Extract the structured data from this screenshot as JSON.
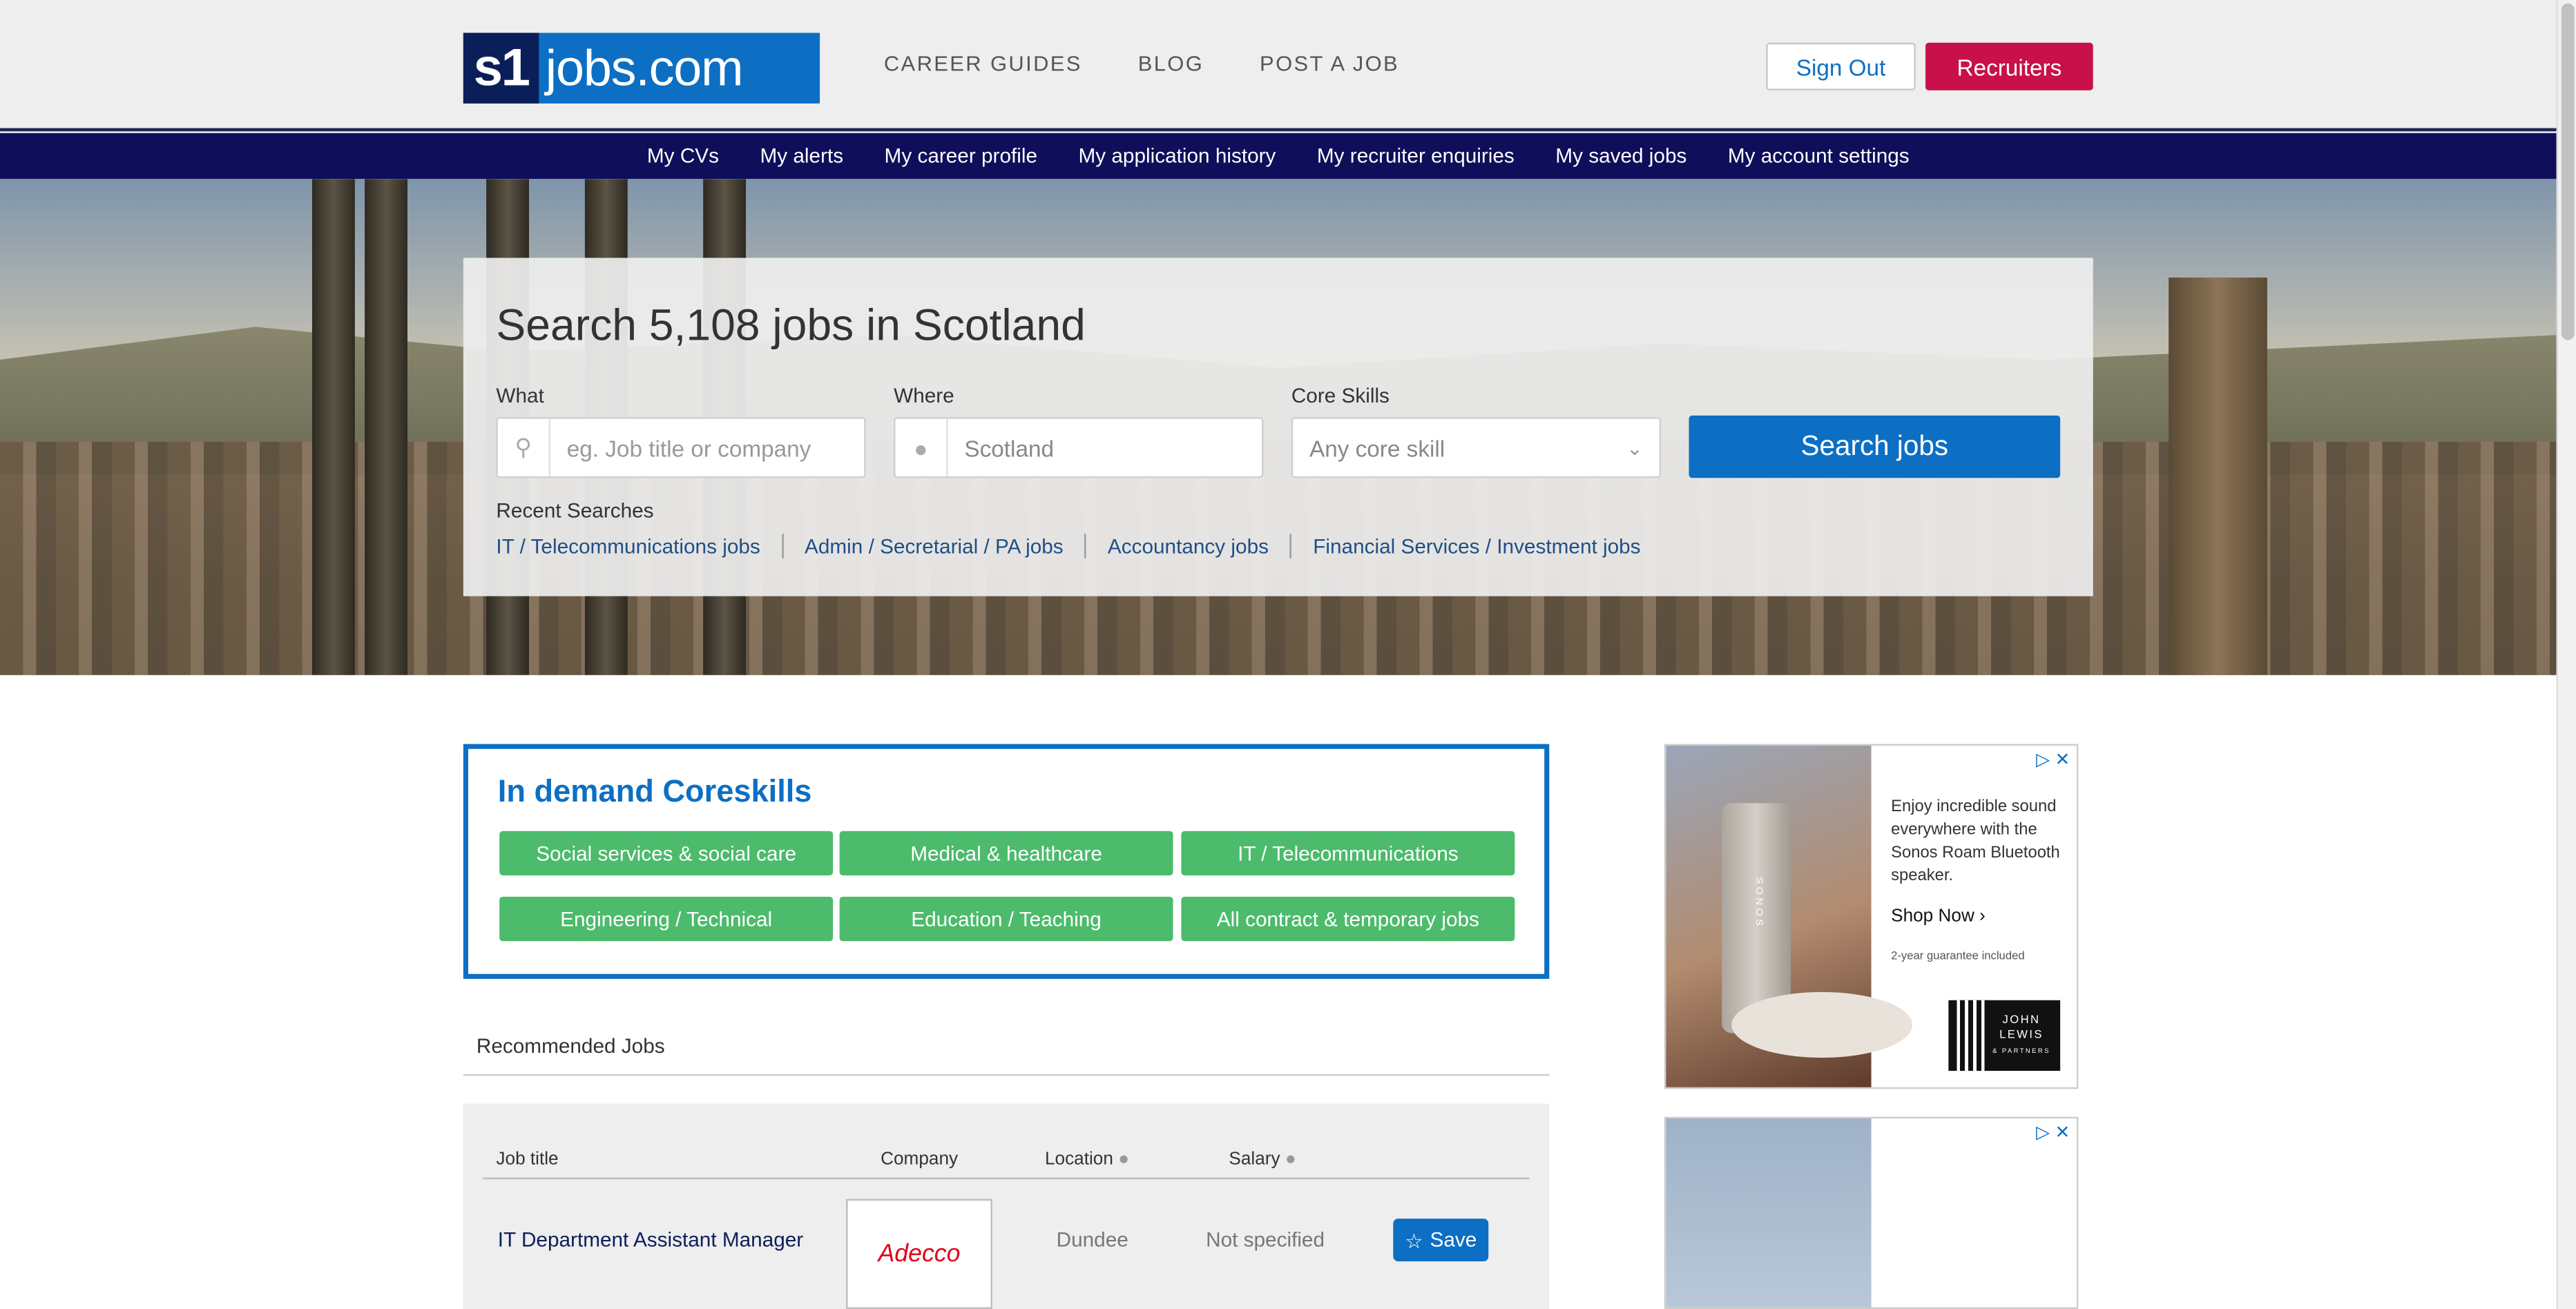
{
  "header": {
    "logo": {
      "mark": "s1",
      "text": "jobs.com"
    },
    "nav": [
      "CAREER GUIDES",
      "BLOG",
      "POST A JOB"
    ],
    "sign_out": "Sign Out",
    "recruiters": "Recruiters"
  },
  "account_nav": [
    "My CVs",
    "My alerts",
    "My career profile",
    "My application history",
    "My recruiter enquiries",
    "My saved jobs",
    "My account settings"
  ],
  "search": {
    "heading": "Search 5,108 jobs in Scotland",
    "what_label": "What",
    "what_placeholder": "eg. Job title or company",
    "where_label": "Where",
    "where_value": "Scotland",
    "core_label": "Core Skills",
    "core_value": "Any core skill",
    "button": "Search jobs",
    "recent_label": "Recent Searches",
    "recent": [
      "IT / Telecommunications jobs",
      "Admin / Secretarial / PA jobs",
      "Accountancy jobs",
      "Financial Services / Investment jobs"
    ]
  },
  "coreskills": {
    "title": "In demand Coreskills",
    "chips": [
      "Social services & social care",
      "Medical & healthcare",
      "IT / Telecommunications",
      "Engineering / Technical",
      "Education / Teaching",
      "All contract & temporary jobs"
    ]
  },
  "recommended": {
    "title": "Recommended Jobs",
    "columns": {
      "job_title": "Job title",
      "company": "Company",
      "location": "Location",
      "salary": "Salary"
    },
    "jobs": [
      {
        "title": "IT Department Assistant Manager",
        "company_logo_text": "Adecco",
        "location": "Dundee",
        "salary": "Not specified",
        "save": "Save"
      }
    ]
  },
  "ads": {
    "ad1": {
      "product_text": "SONOS",
      "text": "Enjoy incredible sound everywhere with the Sonos Roam Bluetooth speaker.",
      "cta": "Shop Now",
      "guarantee": "2-year guarantee included",
      "brand_line1": "JOHN",
      "brand_line2": "LEWIS",
      "brand_line3": "& PARTNERS"
    }
  },
  "colors": {
    "brand_blue": "#0c6fc4",
    "nav_navy": "#0e0e5a",
    "recruiters_red": "#c8104a",
    "chip_green": "#4cbb6c"
  }
}
